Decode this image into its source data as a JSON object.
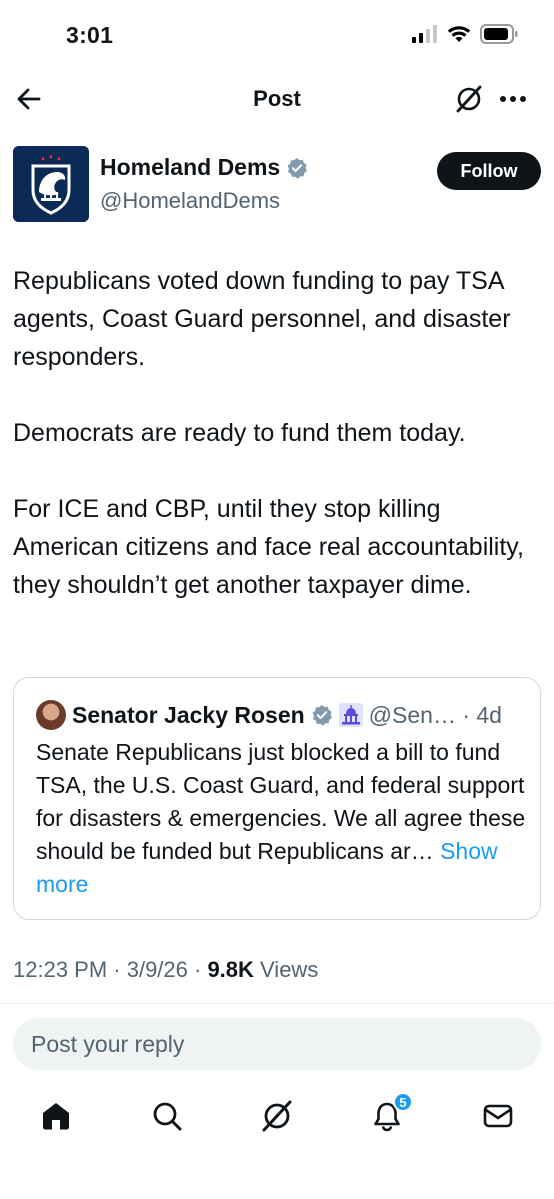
{
  "status_bar": {
    "time": "3:01"
  },
  "header": {
    "title": "Post"
  },
  "author": {
    "name": "Homeland Dems",
    "handle": "@HomelandDems",
    "follow_label": "Follow"
  },
  "post": {
    "paragraphs": [
      "Republicans voted down funding to pay TSA agents, Coast Guard personnel, and disaster responders.",
      "Democrats are ready to fund them today.",
      "For ICE and CBP, until they stop killing American citizens and face real accountability, they shouldn’t get another taxpayer dime."
    ],
    "timestamp": "12:23 PM · 3/9/26 · ",
    "views_count": "9.8K",
    "views_label": " Views"
  },
  "quote": {
    "name": "Senator Jacky Rosen",
    "handle_time": "@Sen… · 4d",
    "text": "Senate Republicans just blocked a bill to fund TSA, the U.S. Coast Guard, and federal support for disasters & emergencies. We all agree these should be funded but Republicans ar… ",
    "show_more": "Show more"
  },
  "reply": {
    "placeholder": "Post your reply"
  },
  "bottom_nav": {
    "items": [
      "home-icon",
      "search-icon",
      "grok-icon",
      "notifications-icon",
      "messages-icon"
    ],
    "notification_badge": "5"
  },
  "colors": {
    "accent": "#1d9bf0",
    "text": "#0f1419",
    "muted": "#536471",
    "verified": "#829aab"
  }
}
